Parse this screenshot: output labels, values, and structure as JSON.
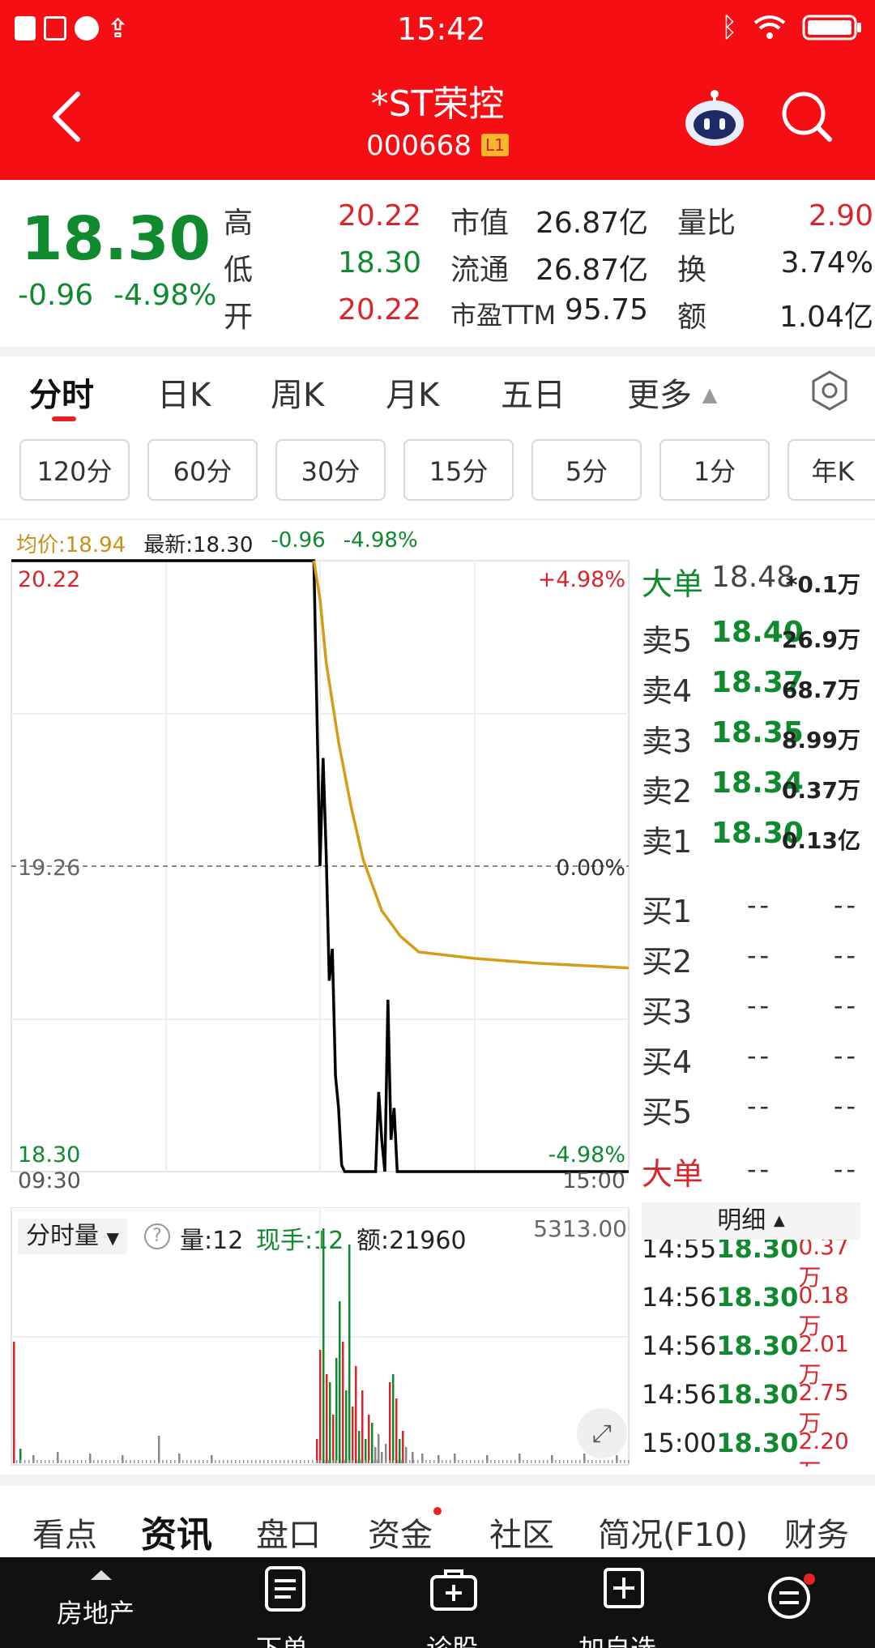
{
  "status_bar": {
    "time": "15:42"
  },
  "header": {
    "title": "*ST荣控",
    "code": "000668",
    "level_badge": "L1"
  },
  "quote": {
    "price": "18.30",
    "change": "-0.96",
    "change_pct": "-4.98%",
    "high_label": "高",
    "high": "20.22",
    "low_label": "低",
    "low": "18.30",
    "open_label": "开",
    "open": "20.22",
    "mcap_label": "市值",
    "mcap": "26.87亿",
    "float_label": "流通",
    "float": "26.87亿",
    "pe_label": "市盈TTM",
    "pe": "95.75",
    "vr_label": "量比",
    "vr": "2.90",
    "turnover_label": "换",
    "turnover": "3.74%",
    "amount_label": "额",
    "amount": "1.04亿"
  },
  "period_tabs": [
    "分时",
    "日K",
    "周K",
    "月K",
    "五日",
    "更多"
  ],
  "minute_pills": [
    "120分",
    "60分",
    "30分",
    "15分",
    "5分",
    "1分",
    "年K"
  ],
  "chart_info": {
    "avg": "均价:18.94",
    "latest": "最新:18.30",
    "chg": "-0.96",
    "chg_pct": "-4.98%"
  },
  "chart_data": {
    "type": "line",
    "x_start": "09:30",
    "x_end": "15:00",
    "ylim": [
      18.3,
      20.22
    ],
    "prev_close": 19.26,
    "y_labels": {
      "top": "20.22",
      "mid": "19.26",
      "bottom": "18.30"
    },
    "pct_labels": {
      "top": "+4.98%",
      "mid": "0.00%",
      "bottom": "-4.98%"
    },
    "series": [
      {
        "color": "#000000",
        "points": [
          [
            0,
            20.22
          ],
          [
            0.49,
            20.22
          ],
          [
            0.5,
            19.26
          ],
          [
            0.505,
            19.6
          ],
          [
            0.51,
            19.3
          ],
          [
            0.515,
            18.9
          ],
          [
            0.52,
            19.0
          ],
          [
            0.525,
            18.6
          ],
          [
            0.53,
            18.5
          ],
          [
            0.535,
            18.32
          ],
          [
            0.54,
            18.3
          ],
          [
            0.59,
            18.3
          ],
          [
            0.595,
            18.55
          ],
          [
            0.6,
            18.4
          ],
          [
            0.605,
            18.3
          ],
          [
            0.61,
            18.84
          ],
          [
            0.615,
            18.4
          ],
          [
            0.62,
            18.5
          ],
          [
            0.625,
            18.3
          ],
          [
            1.0,
            18.3
          ]
        ]
      },
      {
        "color": "#d69c18",
        "points": [
          [
            0.49,
            20.22
          ],
          [
            0.5,
            20.1
          ],
          [
            0.51,
            19.9
          ],
          [
            0.53,
            19.65
          ],
          [
            0.55,
            19.45
          ],
          [
            0.57,
            19.28
          ],
          [
            0.6,
            19.12
          ],
          [
            0.63,
            19.04
          ],
          [
            0.66,
            18.99
          ],
          [
            0.75,
            18.97
          ],
          [
            0.85,
            18.955
          ],
          [
            1.0,
            18.94
          ]
        ]
      }
    ]
  },
  "volume": {
    "title": "分时量",
    "vol": "量:12",
    "hand": "现手:12",
    "amt": "额:21960",
    "max": "5313.00"
  },
  "orderbook": {
    "big_top": {
      "label": "大单",
      "price": "18.48",
      "vol": "*0.1万"
    },
    "asks": [
      {
        "label": "卖5",
        "price": "18.40",
        "vol": "26.9万"
      },
      {
        "label": "卖4",
        "price": "18.37",
        "vol": "68.7万"
      },
      {
        "label": "卖3",
        "price": "18.35",
        "vol": "8.99万"
      },
      {
        "label": "卖2",
        "price": "18.34",
        "vol": "0.37万"
      },
      {
        "label": "卖1",
        "price": "18.30",
        "vol": "0.13亿"
      }
    ],
    "bids": [
      {
        "label": "买1",
        "price": "--",
        "vol": "--"
      },
      {
        "label": "买2",
        "price": "--",
        "vol": "--"
      },
      {
        "label": "买3",
        "price": "--",
        "vol": "--"
      },
      {
        "label": "买4",
        "price": "--",
        "vol": "--"
      },
      {
        "label": "买5",
        "price": "--",
        "vol": "--"
      }
    ],
    "big_bottom": {
      "label": "大单",
      "price": "--",
      "vol": "--"
    }
  },
  "ticks": {
    "title": "明细",
    "rows": [
      {
        "time": "14:55",
        "price": "18.30",
        "vol": "0.37万"
      },
      {
        "time": "14:56",
        "price": "18.30",
        "vol": "0.18万"
      },
      {
        "time": "14:56",
        "price": "18.30",
        "vol": "2.01万"
      },
      {
        "time": "14:56",
        "price": "18.30",
        "vol": "2.75万"
      },
      {
        "time": "15:00",
        "price": "18.30",
        "vol": "2.20万"
      }
    ]
  },
  "bottom_tabs": [
    "看点",
    "资讯",
    "盘口",
    "资金",
    "社区",
    "简况(F10)",
    "财务"
  ],
  "nav": {
    "sector": "房地产",
    "order": "下单",
    "diagnose": "诊股",
    "watchlist": "加自选"
  }
}
